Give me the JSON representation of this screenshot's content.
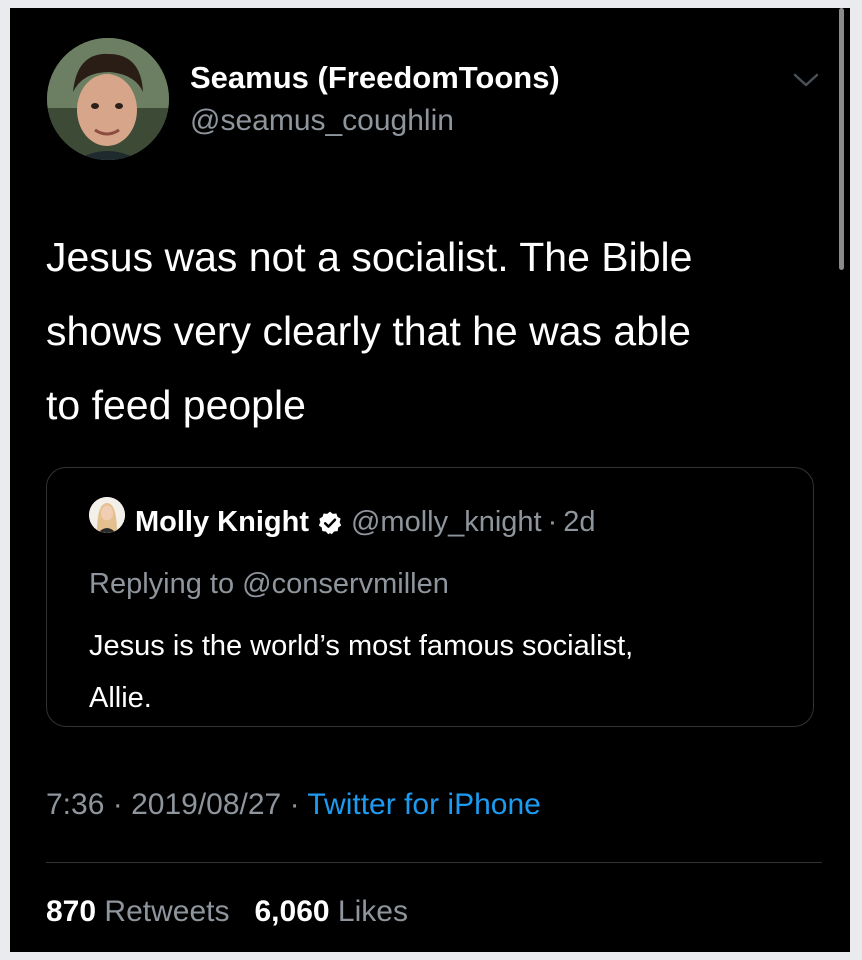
{
  "tweet": {
    "author": {
      "display_name": "Seamus (FreedomToons)",
      "handle": "@seamus_coughlin"
    },
    "text_lines": [
      "Jesus was not a socialist.  The Bible",
      "shows very clearly that he was able",
      "to feed people"
    ],
    "quoted": {
      "author_name": "Molly Knight",
      "verified": true,
      "handle": "@molly_knight",
      "separator": "·",
      "age": "2d",
      "replying_to": "Replying to @conservmillen",
      "text_lines": [
        "Jesus is the world’s most famous socialist,",
        "Allie."
      ]
    },
    "meta": {
      "time": "7:36",
      "sep1": "·",
      "date": "2019/08/27",
      "sep2": "·",
      "source": "Twitter for iPhone"
    },
    "stats": {
      "retweets_count": "870",
      "retweets_label": "Retweets",
      "likes_count": "6,060",
      "likes_label": "Likes"
    }
  },
  "colors": {
    "background": "#000000",
    "text": "#ffffff",
    "secondary_text": "#8e959c",
    "link": "#1d9bf0",
    "border": "#2f3336"
  },
  "icons": {
    "menu": "chevron-down-icon",
    "verified": "verified-badge-icon"
  }
}
